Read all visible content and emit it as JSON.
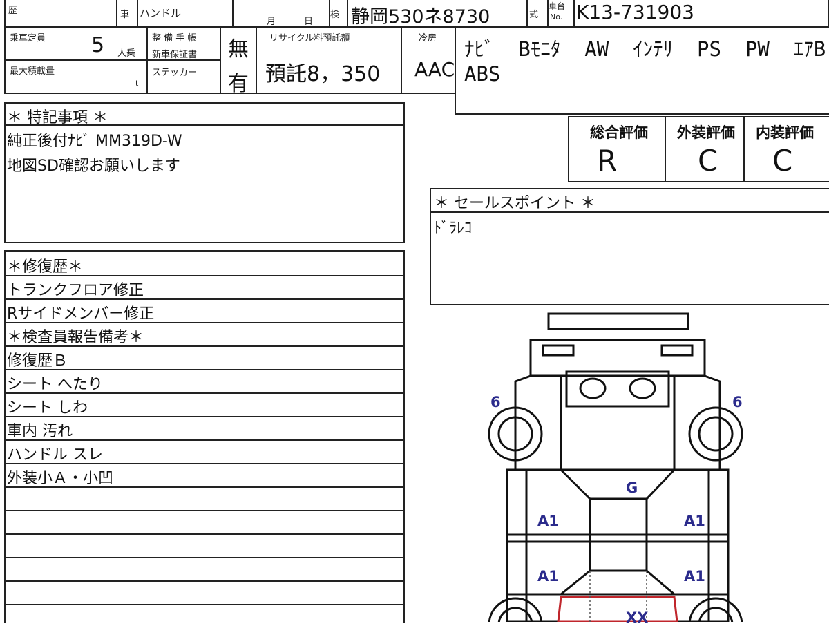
{
  "header": {
    "reki_label": "歴",
    "sha_label": "車",
    "handle_label": "ハンドル",
    "month_label": "月",
    "day_label": "日",
    "ken_label": "検",
    "inspection_value": "静岡530ネ8730",
    "shiki_label": "式",
    "chassis_label_top": "車台",
    "chassis_label_bottom": "No.",
    "chassis_value": "K13-731903"
  },
  "specs": {
    "capacity_label": "乗車定員",
    "capacity_value": "5",
    "capacity_unit": "人乗",
    "maintenance_label_1": "整 備 手 帳",
    "maintenance_label_2": "新車保証書",
    "maintenance_value": "無",
    "sticker_label": "ステッカー",
    "sticker_value": "有",
    "max_load_label": "最大積載量",
    "max_load_unit": "t",
    "recycle_label": "リサイクル料預託額",
    "recycle_value": "預託8，350",
    "cooler_label": "冷房",
    "cooler_value": "AAC"
  },
  "equipment": {
    "line1": "ﾅﾋﾞ  Bﾓﾆﾀ  AW  ｲﾝﾃﾘ  PS  PW  ｴｱB",
    "line2": "ABS"
  },
  "ratings": {
    "overall_label": "総合評価",
    "overall_value": "R",
    "exterior_label": "外装評価",
    "exterior_value": "C",
    "interior_label": "内装評価",
    "interior_value": "C"
  },
  "special_notes": {
    "title": "＊ 特記事項 ＊",
    "line1": "純正後付ﾅﾋﾞ MM319D-W",
    "line2": "地図SD確認お願いします"
  },
  "sales_points": {
    "title": "＊ セールスポイント ＊",
    "line1": "ﾄﾞﾗﾚｺ"
  },
  "repair_history": {
    "title": "＊修復歴＊",
    "items": [
      "トランクフロア修正",
      "Rサイドメンバー修正"
    ]
  },
  "inspector_report": {
    "title": "＊検査員報告備考＊",
    "items": [
      "修復歴Ｂ",
      "シート へたり",
      "シート しわ",
      "車内 汚れ",
      "ハンドル スレ",
      "外装小Ａ・小凹"
    ]
  },
  "diagram": {
    "tire_left": "6",
    "tire_right": "6",
    "glass_mark": "G",
    "mark_a1_1": "A1",
    "mark_a1_2": "A1",
    "mark_a1_3": "A1",
    "mark_a1_4": "A1",
    "mark_xx": "XX",
    "label_color": "#2b2b8c",
    "damage_color": "#c0262c"
  }
}
